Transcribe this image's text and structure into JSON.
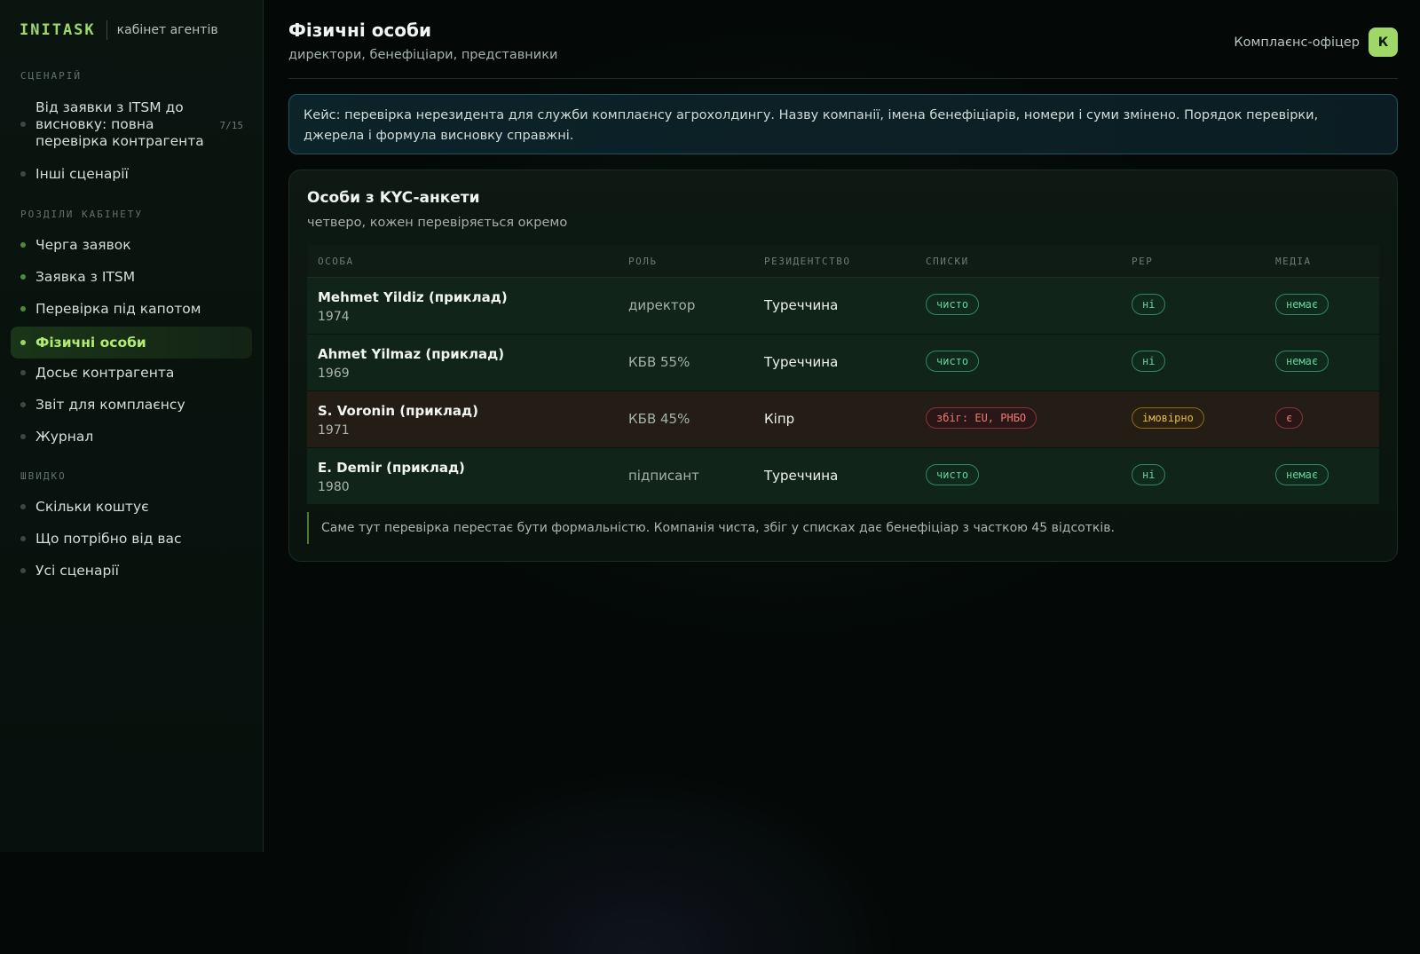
{
  "sidebar": {
    "brand": "INITASK",
    "brand_sub": "кабінет агентів",
    "sections": {
      "scenario": "СЦЕНАРІЙ",
      "cabinet": "РОЗДІЛИ КАБІНЕТУ",
      "quick": "ШВИДКО"
    },
    "scenario_items": [
      {
        "label": "Від заявки з ITSM до висновку: повна перевірка контрагента",
        "count": "7/15"
      },
      {
        "label": "Інші сценарії"
      }
    ],
    "cabinet_items": [
      {
        "label": "Черга заявок"
      },
      {
        "label": "Заявка з ITSM"
      },
      {
        "label": "Перевірка під капотом"
      },
      {
        "label": "Фізичні особи",
        "active": true
      },
      {
        "label": "Досьє контрагента"
      },
      {
        "label": "Звіт для комплаєнсу"
      },
      {
        "label": "Журнал"
      }
    ],
    "quick_items": [
      {
        "label": "Скільки коштує"
      },
      {
        "label": "Що потрібно від вас"
      },
      {
        "label": "Усі сценарії"
      }
    ]
  },
  "header": {
    "title": "Фізичні особи",
    "subtitle": "директори, бенефіціари, представники",
    "user_role": "Комплаєнс-офіцер",
    "avatar_letter": "К"
  },
  "case_text": "Кейс: перевірка нерезидента для служби комплаєнсу агрохолдингу. Назву компанії, імена бенефіціарів, номери і суми змінено. Порядок перевірки, джерела і формула висновку справжні.",
  "panel": {
    "title": "Особи з KYC-анкети",
    "subtitle": "четверо, кожен перевіряється окремо",
    "columns": [
      "ОСОБА",
      "РОЛЬ",
      "РЕЗИДЕНТСТВО",
      "СПИСКИ",
      "PEP",
      "МЕДІА"
    ],
    "rows": [
      {
        "name": "Mehmet Yildiz (приклад)",
        "year": "1974",
        "role": "директор",
        "residency": "Туреччина",
        "lists": "чисто",
        "pep": "ні",
        "media": "немає",
        "status": "ok"
      },
      {
        "name": "Ahmet Yilmaz (приклад)",
        "year": "1969",
        "role": "КБВ 55%",
        "residency": "Туреччина",
        "lists": "чисто",
        "pep": "ні",
        "media": "немає",
        "status": "ok"
      },
      {
        "name": "S. Voronin (приклад)",
        "year": "1971",
        "role": "КБВ 45%",
        "residency": "Кіпр",
        "lists": "збіг: EU, РНБО",
        "pep": "імовірно",
        "media": "є",
        "status": "alert"
      },
      {
        "name": "E. Demir (приклад)",
        "year": "1980",
        "role": "підписант",
        "residency": "Туреччина",
        "lists": "чисто",
        "pep": "ні",
        "media": "немає",
        "status": "ok"
      }
    ],
    "note": "Саме тут перевірка перестає бути формальністю. Компанія чиста, збіг у списках дає бенефіціар з часткою 45 відсотків."
  },
  "colors": {
    "accent": "#9fd867",
    "ok": "#63d39a",
    "danger": "#ec7d72",
    "warning": "#e9b94c"
  }
}
